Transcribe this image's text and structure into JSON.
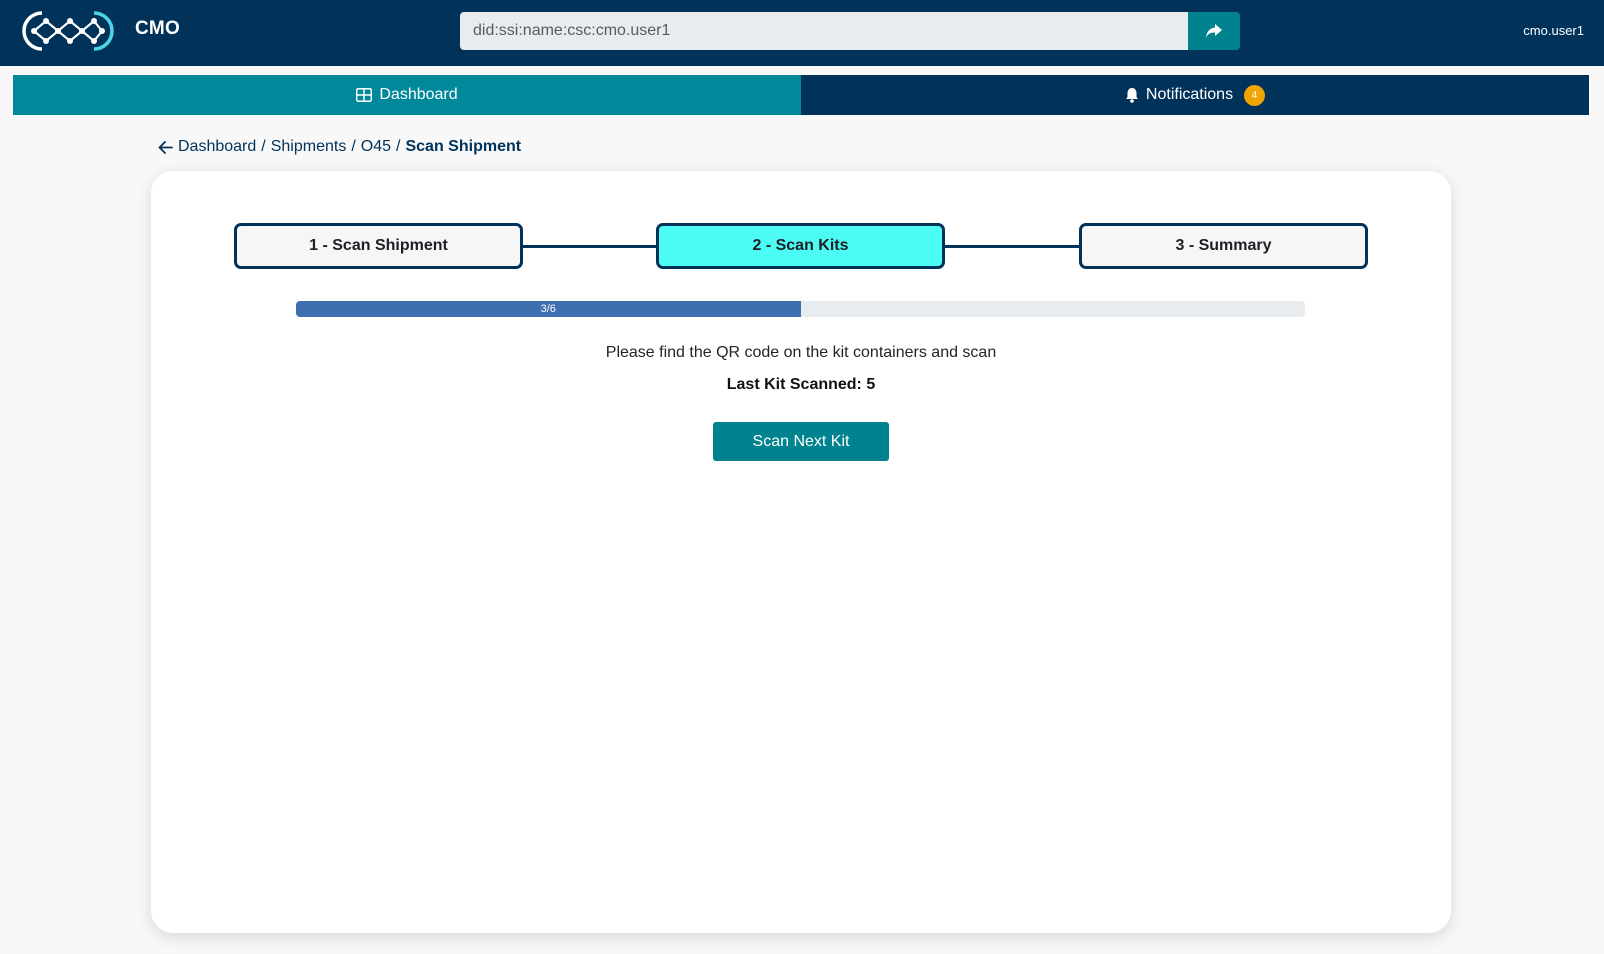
{
  "header": {
    "app_name": "CMO",
    "did_value": "did:ssi:name:csc:cmo.user1",
    "user": "cmo.user1",
    "logo_icon": "network-logo-icon",
    "go_icon": "share-arrow-icon"
  },
  "nav": {
    "dashboard_label": "Dashboard",
    "notifications_label": "Notifications",
    "notifications_count": "4"
  },
  "breadcrumb": {
    "items": [
      "Dashboard",
      "Shipments",
      "O45"
    ],
    "current": "Scan Shipment"
  },
  "stepper": {
    "steps": [
      "1 - Scan Shipment",
      "2 - Scan Kits",
      "3 - Summary"
    ],
    "active_index": 1
  },
  "progress": {
    "label": "3/6",
    "current": 3,
    "total": 6
  },
  "content": {
    "instructions": "Please find the QR code on the kit containers and scan",
    "last_kit": "Last Kit Scanned: 5",
    "scan_button_label": "Scan Next Kit"
  },
  "colors": {
    "primary_dark": "#00325a",
    "teal": "#01899b",
    "active_step": "#4cfcf4",
    "progress": "#3e6fb0",
    "badge": "#f0a500"
  }
}
